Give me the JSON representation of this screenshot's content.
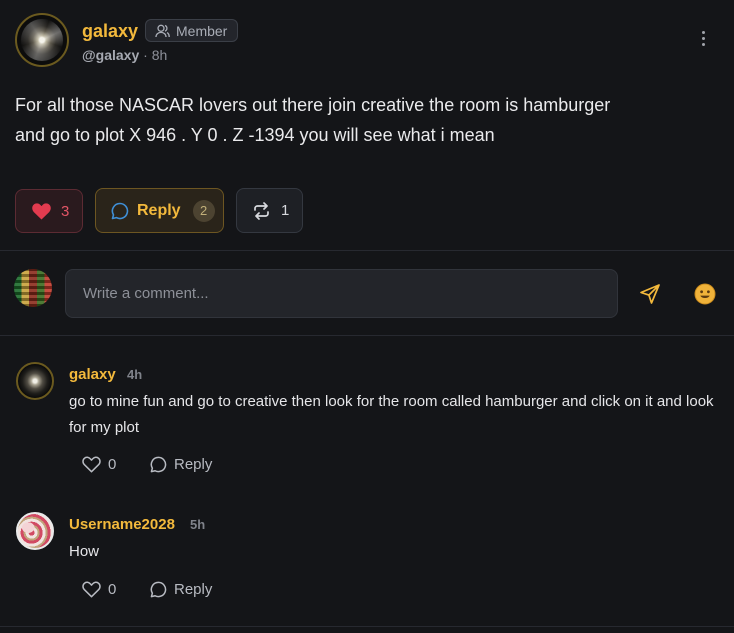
{
  "post": {
    "author": "galaxy",
    "role": "Member",
    "handle": "@galaxy",
    "separator": "·",
    "time": "8h",
    "body_line1": "For all those NASCAR lovers out there join creative the room is hamburger",
    "body_line2": "and go to plot X 946 . Y 0 . Z -1394 you will see what i mean",
    "likes": "3",
    "reply_label": "Reply",
    "replies": "2",
    "reposts": "1"
  },
  "composer": {
    "placeholder": "Write a comment..."
  },
  "comments": [
    {
      "author": "galaxy",
      "time": "4h",
      "text": "go to mine fun and go to creative then look for the room called hamburger and click on it and look for my plot",
      "likes": "0",
      "reply_label": "Reply"
    },
    {
      "author": "Username2028",
      "time": "5h",
      "text": "How",
      "likes": "0",
      "reply_label": "Reply"
    }
  ],
  "colors": {
    "background": "#141518",
    "accent": "#f3b93c",
    "like": "#e25566"
  },
  "icons": [
    "user-icon",
    "kebab-icon",
    "heart-icon",
    "comment-bubble-icon",
    "repost-icon",
    "send-icon",
    "emoji-icon"
  ]
}
